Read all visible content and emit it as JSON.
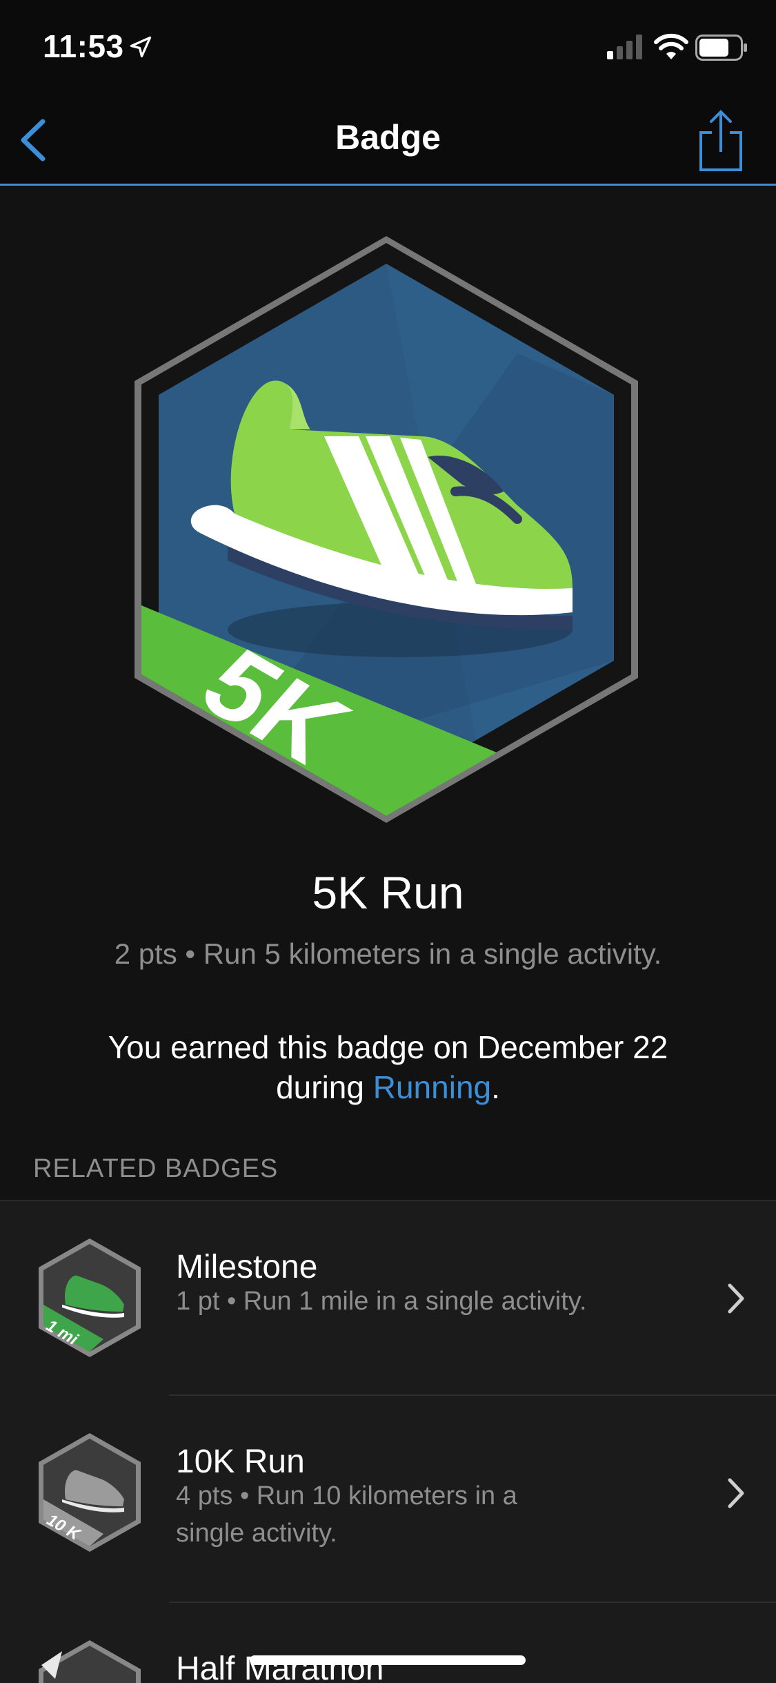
{
  "status_bar": {
    "time": "11:53"
  },
  "nav": {
    "title": "Badge"
  },
  "badge": {
    "label": "5K",
    "title": "5K Run",
    "description": "2 pts • Run 5 kilometers in a single activity.",
    "earned_prefix": "You earned this badge on December 22 during ",
    "earned_link": "Running",
    "earned_suffix": "."
  },
  "related": {
    "header": "RELATED BADGES",
    "items": [
      {
        "title": "Milestone",
        "description": "1 pt • Run 1 mile in a single activity.",
        "icon_label": "1 mi"
      },
      {
        "title": "10K Run",
        "description": "4 pts • Run 10 kilometers in a single activity.",
        "icon_label": "10 K"
      },
      {
        "title": "Half Marathon",
        "description": "",
        "icon_label": ""
      }
    ]
  },
  "colors": {
    "accent": "#3b8fd9",
    "badge_blue": "#2c5a82",
    "badge_green": "#5bbd3c",
    "background": "#121212"
  }
}
